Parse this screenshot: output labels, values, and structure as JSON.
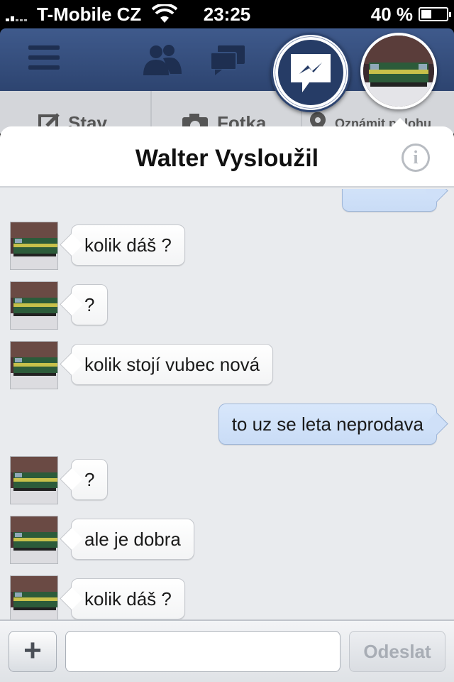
{
  "status_bar": {
    "carrier": "T-Mobile CZ",
    "time": "23:25",
    "battery_percent": "40 %",
    "battery_level": 0.4
  },
  "fb_navbar": {
    "icons": [
      "menu-icon",
      "friends-icon",
      "messages-icon",
      "messenger-icon"
    ]
  },
  "fb_composer": {
    "status_label": "Stav",
    "photo_label": "Fotka",
    "location_label": "Oznámit polohu"
  },
  "chat": {
    "contact_name": "Walter Vysloužil",
    "messages": [
      {
        "direction": "outgoing",
        "text": ""
      },
      {
        "direction": "incoming",
        "text": "kolik  dáš  ?"
      },
      {
        "direction": "incoming",
        "text": "?"
      },
      {
        "direction": "incoming",
        "text": "kolik stojí  vubec  nová"
      },
      {
        "direction": "outgoing",
        "text": "to uz se leta neprodava"
      },
      {
        "direction": "incoming",
        "text": "?"
      },
      {
        "direction": "incoming",
        "text": "ale  je  dobra"
      },
      {
        "direction": "incoming",
        "text": "kolik  dáš ?"
      }
    ]
  },
  "input_bar": {
    "add_label": "+",
    "input_value": "",
    "send_label": "Odeslat"
  },
  "colors": {
    "navbar": "#3b5998",
    "outgoing_bubble": "#cfe0f8",
    "incoming_bubble": "#ffffff",
    "chat_background": "#e9ebee"
  }
}
